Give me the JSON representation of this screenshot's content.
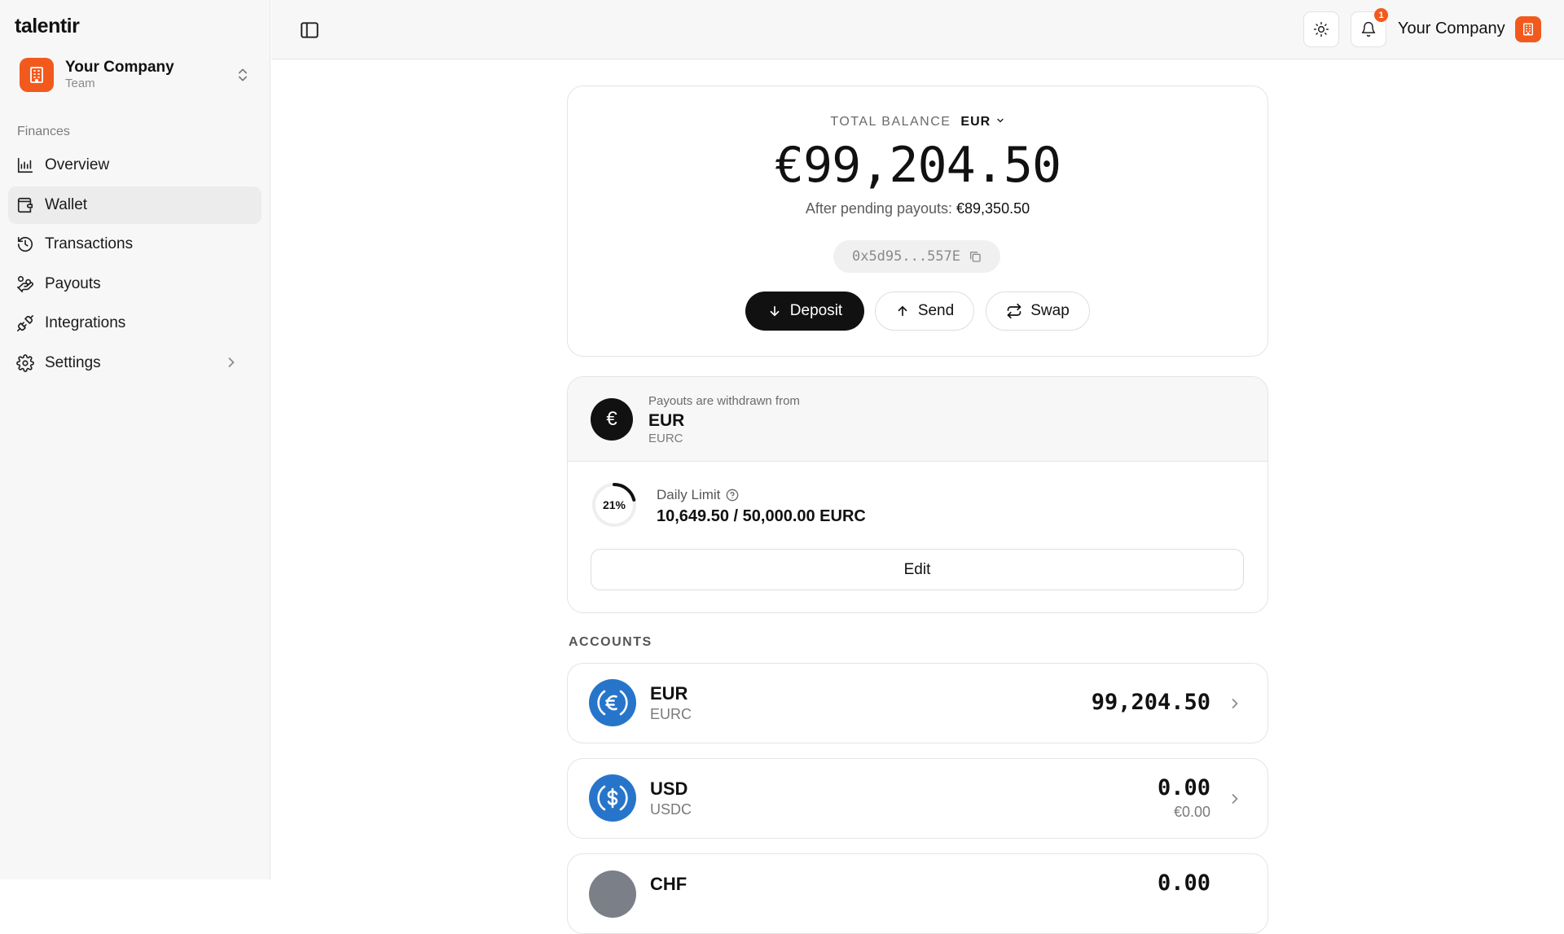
{
  "brand": "talentir",
  "team": {
    "name": "Your Company",
    "role": "Team"
  },
  "sidebar": {
    "section": "Finances",
    "items": [
      {
        "label": "Overview",
        "icon": "chart-icon"
      },
      {
        "label": "Wallet",
        "icon": "wallet-icon",
        "active": true
      },
      {
        "label": "Transactions",
        "icon": "history-icon"
      },
      {
        "label": "Payouts",
        "icon": "payouts-icon"
      },
      {
        "label": "Integrations",
        "icon": "plug-icon"
      },
      {
        "label": "Settings",
        "icon": "gear-icon"
      }
    ]
  },
  "topbar": {
    "notification_count": "1",
    "company": "Your Company"
  },
  "balance": {
    "label": "TOTAL BALANCE",
    "currency": "EUR",
    "amount": "€99,204.50",
    "pending_label": "After pending payouts:",
    "pending_amount": "€89,350.50",
    "address": "0x5d95...557E",
    "deposit": "Deposit",
    "send": "Send",
    "swap": "Swap"
  },
  "payout": {
    "subtitle": "Payouts are withdrawn from",
    "currency": "EUR",
    "token": "EURC",
    "currency_symbol": "€",
    "limit_label": "Daily Limit",
    "limit_percent": "21%",
    "limit_fraction": 0.21,
    "limit_value": "10,649.50 / 50,000.00 EURC",
    "edit": "Edit"
  },
  "accounts": {
    "label": "ACCOUNTS",
    "items": [
      {
        "currency": "EUR",
        "token": "EURC",
        "amount": "99,204.50",
        "sub": ""
      },
      {
        "currency": "USD",
        "token": "USDC",
        "amount": "0.00",
        "sub": "€0.00"
      },
      {
        "currency": "CHF",
        "token": "",
        "amount": "0.00",
        "sub": ""
      }
    ]
  },
  "colors": {
    "accent": "#f25a1d",
    "usdc_blue": "#2775ca",
    "dark": "#111111"
  }
}
